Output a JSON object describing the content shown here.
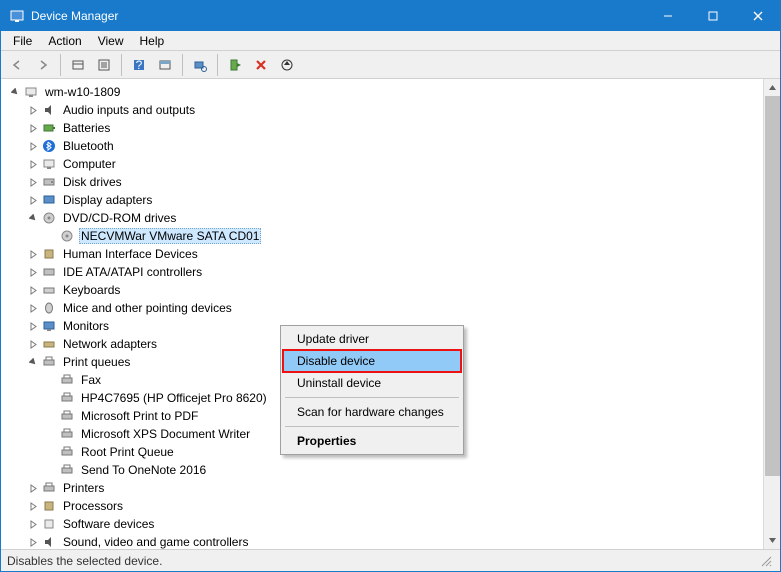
{
  "window": {
    "title": "Device Manager"
  },
  "menu": {
    "file": "File",
    "action": "Action",
    "view": "View",
    "help": "Help"
  },
  "tree": {
    "root": "wm-w10-1809",
    "cat": {
      "audio": "Audio inputs and outputs",
      "batteries": "Batteries",
      "bluetooth": "Bluetooth",
      "computer": "Computer",
      "disk": "Disk drives",
      "display": "Display adapters",
      "dvd": "DVD/CD-ROM drives",
      "hid": "Human Interface Devices",
      "ide": "IDE ATA/ATAPI controllers",
      "keyboards": "Keyboards",
      "mice": "Mice and other pointing devices",
      "monitors": "Monitors",
      "network": "Network adapters",
      "printq": "Print queues",
      "printers": "Printers",
      "processors": "Processors",
      "software": "Software devices",
      "sound": "Sound, video and game controllers"
    },
    "dvd_child": "NECVMWar VMware SATA CD01",
    "pq": {
      "fax": "Fax",
      "hp": "HP4C7695 (HP Officejet Pro 8620)",
      "mspdf": "Microsoft Print to PDF",
      "msxps": "Microsoft XPS Document Writer",
      "rootq": "Root Print Queue",
      "onenote": "Send To OneNote 2016"
    }
  },
  "context_menu": {
    "update": "Update driver",
    "disable": "Disable device",
    "uninstall": "Uninstall device",
    "scan": "Scan for hardware changes",
    "properties": "Properties"
  },
  "statusbar": {
    "text": "Disables the selected device."
  }
}
